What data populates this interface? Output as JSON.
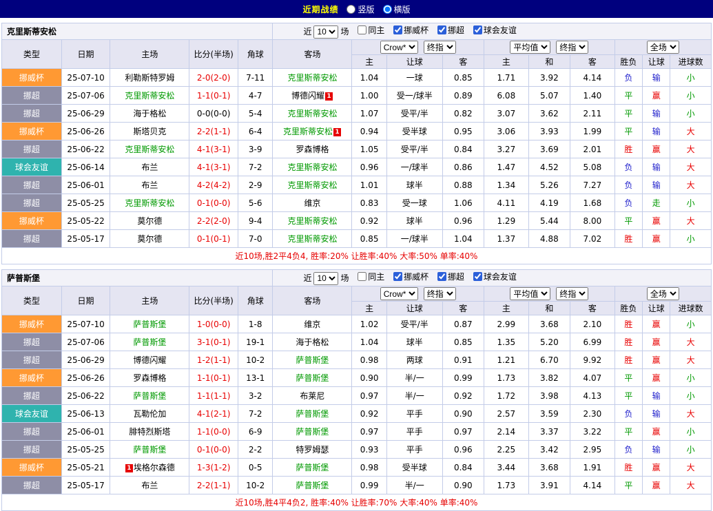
{
  "topbar": {
    "title": "近期战绩",
    "vertical": "竖版",
    "horizontal": "横版"
  },
  "filters": {
    "near_label": "近",
    "count": "10",
    "field_label": "场",
    "same_home": "同主",
    "cup1": "挪威杯",
    "cup2": "挪超",
    "cup3": "球会友谊"
  },
  "selects": {
    "company": "Crow*",
    "company_final": "终指",
    "average": "平均值",
    "average_final": "终指",
    "fulltime": "全场"
  },
  "columns": {
    "type": "类型",
    "date": "日期",
    "home": "主场",
    "score": "比分(半场)",
    "corner": "角球",
    "away": "客场",
    "h": "主",
    "line": "让球",
    "a": "客",
    "eh": "主",
    "ed": "和",
    "ea": "客",
    "wdl": "胜负",
    "ahr": "让球",
    "goals": "进球数"
  },
  "colors": {
    "accent_navy": "#00007e",
    "title_yellow": "#ffff00",
    "cup_orange": "#ff9933",
    "league_gray": "#8e8ea6",
    "friendly_teal": "#2fb3ae",
    "win_red": "#e80000",
    "lose_blue": "#2222cc",
    "draw_green": "#009900"
  },
  "tables": [
    {
      "team": "克里斯蒂安松",
      "summary": "近10场,胜2平4负4, 胜率:20% 让胜率:40% 大率:50% 单率:40%",
      "rows": [
        {
          "lg": "挪威杯",
          "lgc": "cup",
          "date": "25-07-10",
          "home": "利勒斯特罗姆",
          "hg": false,
          "score": "2-0(2-0)",
          "sc": "red",
          "corner": "7-11",
          "away": "克里斯蒂安松",
          "ag": true,
          "ah": [
            "1.04",
            "一球",
            "0.85"
          ],
          "eu": [
            "1.71",
            "3.92",
            "4.14"
          ],
          "res": "负",
          "resc": "blue",
          "ahr": "输",
          "ahrc": "blue",
          "gl": "小",
          "glc": "green"
        },
        {
          "lg": "挪超",
          "lgc": "league",
          "date": "25-07-06",
          "home": "克里斯蒂安松",
          "hg": true,
          "score": "1-1(0-1)",
          "sc": "red",
          "corner": "4-7",
          "away": "博德闪耀",
          "ag": false,
          "apost": "1",
          "ah": [
            "1.00",
            "受一/球半",
            "0.89"
          ],
          "eu": [
            "6.08",
            "5.07",
            "1.40"
          ],
          "res": "平",
          "resc": "green",
          "ahr": "赢",
          "ahrc": "red",
          "gl": "小",
          "glc": "green"
        },
        {
          "lg": "挪超",
          "lgc": "league",
          "date": "25-06-29",
          "home": "海于格松",
          "hg": false,
          "score": "0-0(0-0)",
          "sc": "black",
          "corner": "5-4",
          "away": "克里斯蒂安松",
          "ag": true,
          "ah": [
            "1.07",
            "受平/半",
            "0.82"
          ],
          "eu": [
            "3.07",
            "3.62",
            "2.11"
          ],
          "res": "平",
          "resc": "green",
          "ahr": "输",
          "ahrc": "blue",
          "gl": "小",
          "glc": "green"
        },
        {
          "lg": "挪威杯",
          "lgc": "cup",
          "date": "25-06-26",
          "home": "斯塔贝克",
          "hg": false,
          "score": "2-2(1-1)",
          "sc": "red",
          "corner": "6-4",
          "away": "克里斯蒂安松",
          "ag": true,
          "apost": "1",
          "ah": [
            "0.94",
            "受半球",
            "0.95"
          ],
          "eu": [
            "3.06",
            "3.93",
            "1.99"
          ],
          "res": "平",
          "resc": "green",
          "ahr": "输",
          "ahrc": "blue",
          "gl": "大",
          "glc": "red"
        },
        {
          "lg": "挪超",
          "lgc": "league",
          "date": "25-06-22",
          "home": "克里斯蒂安松",
          "hg": true,
          "score": "4-1(3-1)",
          "sc": "red",
          "corner": "3-9",
          "away": "罗森博格",
          "ag": false,
          "ah": [
            "1.05",
            "受平/半",
            "0.84"
          ],
          "eu": [
            "3.27",
            "3.69",
            "2.01"
          ],
          "res": "胜",
          "resc": "red",
          "ahr": "赢",
          "ahrc": "red",
          "gl": "大",
          "glc": "red"
        },
        {
          "lg": "球会友谊",
          "lgc": "friendly",
          "date": "25-06-14",
          "home": "布兰",
          "hg": false,
          "score": "4-1(3-1)",
          "sc": "red",
          "corner": "7-2",
          "away": "克里斯蒂安松",
          "ag": true,
          "ah": [
            "0.96",
            "一/球半",
            "0.86"
          ],
          "eu": [
            "1.47",
            "4.52",
            "5.08"
          ],
          "res": "负",
          "resc": "blue",
          "ahr": "输",
          "ahrc": "blue",
          "gl": "大",
          "glc": "red"
        },
        {
          "lg": "挪超",
          "lgc": "league",
          "date": "25-06-01",
          "home": "布兰",
          "hg": false,
          "score": "4-2(4-2)",
          "sc": "red",
          "corner": "2-9",
          "away": "克里斯蒂安松",
          "ag": true,
          "ah": [
            "1.01",
            "球半",
            "0.88"
          ],
          "eu": [
            "1.34",
            "5.26",
            "7.27"
          ],
          "res": "负",
          "resc": "blue",
          "ahr": "输",
          "ahrc": "blue",
          "gl": "大",
          "glc": "red"
        },
        {
          "lg": "挪超",
          "lgc": "league",
          "date": "25-05-25",
          "home": "克里斯蒂安松",
          "hg": true,
          "score": "0-1(0-0)",
          "sc": "red",
          "corner": "5-6",
          "away": "维京",
          "ag": false,
          "ah": [
            "0.83",
            "受一球",
            "1.06"
          ],
          "eu": [
            "4.11",
            "4.19",
            "1.68"
          ],
          "res": "负",
          "resc": "blue",
          "ahr": "走",
          "ahrc": "green",
          "gl": "小",
          "glc": "green"
        },
        {
          "lg": "挪威杯",
          "lgc": "cup",
          "date": "25-05-22",
          "home": "莫尔德",
          "hg": false,
          "score": "2-2(2-0)",
          "sc": "red",
          "corner": "9-4",
          "away": "克里斯蒂安松",
          "ag": true,
          "ah": [
            "0.92",
            "球半",
            "0.96"
          ],
          "eu": [
            "1.29",
            "5.44",
            "8.00"
          ],
          "res": "平",
          "resc": "green",
          "ahr": "赢",
          "ahrc": "red",
          "gl": "大",
          "glc": "red"
        },
        {
          "lg": "挪超",
          "lgc": "league",
          "date": "25-05-17",
          "home": "莫尔德",
          "hg": false,
          "score": "0-1(0-1)",
          "sc": "red",
          "corner": "7-0",
          "away": "克里斯蒂安松",
          "ag": true,
          "ah": [
            "0.85",
            "一/球半",
            "1.04"
          ],
          "eu": [
            "1.37",
            "4.88",
            "7.02"
          ],
          "res": "胜",
          "resc": "red",
          "ahr": "赢",
          "ahrc": "red",
          "gl": "小",
          "glc": "green"
        }
      ]
    },
    {
      "team": "萨普斯堡",
      "summary": "近10场,胜4平4负2, 胜率:40% 让胜率:70% 大率:40% 单率:40%",
      "rows": [
        {
          "lg": "挪威杯",
          "lgc": "cup",
          "date": "25-07-10",
          "home": "萨普斯堡",
          "hg": true,
          "score": "1-0(0-0)",
          "sc": "red",
          "corner": "1-8",
          "away": "维京",
          "ag": false,
          "ah": [
            "1.02",
            "受平/半",
            "0.87"
          ],
          "eu": [
            "2.99",
            "3.68",
            "2.10"
          ],
          "res": "胜",
          "resc": "red",
          "ahr": "赢",
          "ahrc": "red",
          "gl": "小",
          "glc": "green"
        },
        {
          "lg": "挪超",
          "lgc": "league",
          "date": "25-07-06",
          "home": "萨普斯堡",
          "hg": true,
          "score": "3-1(0-1)",
          "sc": "red",
          "corner": "19-1",
          "away": "海于格松",
          "ag": false,
          "ah": [
            "1.04",
            "球半",
            "0.85"
          ],
          "eu": [
            "1.35",
            "5.20",
            "6.99"
          ],
          "res": "胜",
          "resc": "red",
          "ahr": "赢",
          "ahrc": "red",
          "gl": "大",
          "glc": "red"
        },
        {
          "lg": "挪超",
          "lgc": "league",
          "date": "25-06-29",
          "home": "博德闪耀",
          "hg": false,
          "score": "1-2(1-1)",
          "sc": "red",
          "corner": "10-2",
          "away": "萨普斯堡",
          "ag": true,
          "ah": [
            "0.98",
            "两球",
            "0.91"
          ],
          "eu": [
            "1.21",
            "6.70",
            "9.92"
          ],
          "res": "胜",
          "resc": "red",
          "ahr": "赢",
          "ahrc": "red",
          "gl": "大",
          "glc": "red"
        },
        {
          "lg": "挪威杯",
          "lgc": "cup",
          "date": "25-06-26",
          "home": "罗森博格",
          "hg": false,
          "score": "1-1(0-1)",
          "sc": "red",
          "corner": "13-1",
          "away": "萨普斯堡",
          "ag": true,
          "ah": [
            "0.90",
            "半/一",
            "0.99"
          ],
          "eu": [
            "1.73",
            "3.82",
            "4.07"
          ],
          "res": "平",
          "resc": "green",
          "ahr": "赢",
          "ahrc": "red",
          "gl": "小",
          "glc": "green"
        },
        {
          "lg": "挪超",
          "lgc": "league",
          "date": "25-06-22",
          "home": "萨普斯堡",
          "hg": true,
          "score": "1-1(1-1)",
          "sc": "red",
          "corner": "3-2",
          "away": "布莱尼",
          "ag": false,
          "ah": [
            "0.97",
            "半/一",
            "0.92"
          ],
          "eu": [
            "1.72",
            "3.98",
            "4.13"
          ],
          "res": "平",
          "resc": "green",
          "ahr": "输",
          "ahrc": "blue",
          "gl": "小",
          "glc": "green"
        },
        {
          "lg": "球会友谊",
          "lgc": "friendly",
          "date": "25-06-13",
          "home": "瓦勒伦加",
          "hg": false,
          "score": "4-1(2-1)",
          "sc": "red",
          "corner": "7-2",
          "away": "萨普斯堡",
          "ag": true,
          "ah": [
            "0.92",
            "平手",
            "0.90"
          ],
          "eu": [
            "2.57",
            "3.59",
            "2.30"
          ],
          "res": "负",
          "resc": "blue",
          "ahr": "输",
          "ahrc": "blue",
          "gl": "大",
          "glc": "red"
        },
        {
          "lg": "挪超",
          "lgc": "league",
          "date": "25-06-01",
          "home": "腓特烈斯塔",
          "hg": false,
          "score": "1-1(0-0)",
          "sc": "red",
          "corner": "6-9",
          "away": "萨普斯堡",
          "ag": true,
          "ah": [
            "0.97",
            "平手",
            "0.97"
          ],
          "eu": [
            "2.14",
            "3.37",
            "3.22"
          ],
          "res": "平",
          "resc": "green",
          "ahr": "赢",
          "ahrc": "red",
          "gl": "小",
          "glc": "green"
        },
        {
          "lg": "挪超",
          "lgc": "league",
          "date": "25-05-25",
          "home": "萨普斯堡",
          "hg": true,
          "score": "0-1(0-0)",
          "sc": "red",
          "corner": "2-2",
          "away": "特罗姆瑟",
          "ag": false,
          "ah": [
            "0.93",
            "平手",
            "0.96"
          ],
          "eu": [
            "2.25",
            "3.42",
            "2.95"
          ],
          "res": "负",
          "resc": "blue",
          "ahr": "输",
          "ahrc": "blue",
          "gl": "小",
          "glc": "green"
        },
        {
          "lg": "挪威杯",
          "lgc": "cup",
          "date": "25-05-21",
          "home": "埃格尔森德",
          "hg": false,
          "hpre": "1",
          "score": "1-3(1-2)",
          "sc": "red",
          "corner": "0-5",
          "away": "萨普斯堡",
          "ag": true,
          "ah": [
            "0.98",
            "受半球",
            "0.84"
          ],
          "eu": [
            "3.44",
            "3.68",
            "1.91"
          ],
          "res": "胜",
          "resc": "red",
          "ahr": "赢",
          "ahrc": "red",
          "gl": "大",
          "glc": "red"
        },
        {
          "lg": "挪超",
          "lgc": "league",
          "date": "25-05-17",
          "home": "布兰",
          "hg": false,
          "score": "2-2(1-1)",
          "sc": "red",
          "corner": "10-2",
          "away": "萨普斯堡",
          "ag": true,
          "ah": [
            "0.99",
            "半/一",
            "0.90"
          ],
          "eu": [
            "1.73",
            "3.91",
            "4.14"
          ],
          "res": "平",
          "resc": "green",
          "ahr": "赢",
          "ahrc": "red",
          "gl": "大",
          "glc": "red"
        }
      ]
    }
  ]
}
